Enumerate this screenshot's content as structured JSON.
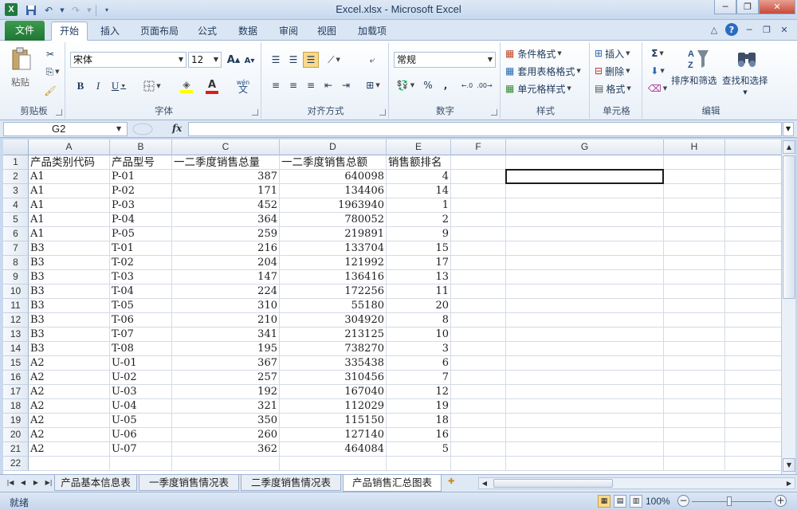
{
  "window": {
    "title": "Excel.xlsx - Microsoft Excel",
    "app_icon": "X",
    "minimize": "─",
    "restore": "❐",
    "close": "✕"
  },
  "tabs": {
    "file": "文件",
    "items": [
      "开始",
      "插入",
      "页面布局",
      "公式",
      "数据",
      "审阅",
      "视图",
      "加载项"
    ],
    "active": "开始"
  },
  "ribbon": {
    "clipboard": {
      "label": "剪贴板",
      "paste": "粘贴"
    },
    "font": {
      "label": "字体",
      "font_name": "宋体",
      "font_size": "12",
      "bold": "B",
      "italic": "I",
      "underline": "U",
      "grow": "A",
      "shrink": "A",
      "wen": "wén"
    },
    "alignment": {
      "label": "对齐方式"
    },
    "number": {
      "label": "数字",
      "format": "常规",
      "percent": "%",
      "comma": ","
    },
    "styles": {
      "label": "样式",
      "conditional": "条件格式",
      "table": "套用表格格式",
      "cell": "单元格样式"
    },
    "cells": {
      "label": "单元格",
      "insert": "插入",
      "delete": "删除",
      "format": "格式"
    },
    "editing": {
      "label": "编辑",
      "sort_filter": "排序和筛选",
      "find_select": "查找和选择",
      "sigma": "Σ"
    }
  },
  "formula_bar": {
    "name_box": "G2",
    "fx": "fx",
    "value": ""
  },
  "columns": [
    "A",
    "B",
    "C",
    "D",
    "E",
    "F",
    "G",
    "H",
    "I"
  ],
  "rows": [
    "1",
    "2",
    "3",
    "4",
    "5",
    "6",
    "7",
    "8",
    "9",
    "10",
    "11",
    "12",
    "13",
    "14",
    "15",
    "16",
    "17",
    "18",
    "19",
    "20",
    "21",
    "22"
  ],
  "table": {
    "headers": [
      "产品类别代码",
      "产品型号",
      "一二季度销售总量",
      "一二季度销售总额",
      "销售额排名"
    ],
    "data": [
      [
        "A1",
        "P-01",
        "387",
        "640098",
        "4"
      ],
      [
        "A1",
        "P-02",
        "171",
        "134406",
        "14"
      ],
      [
        "A1",
        "P-03",
        "452",
        "1963940",
        "1"
      ],
      [
        "A1",
        "P-04",
        "364",
        "780052",
        "2"
      ],
      [
        "A1",
        "P-05",
        "259",
        "219891",
        "9"
      ],
      [
        "B3",
        "T-01",
        "216",
        "133704",
        "15"
      ],
      [
        "B3",
        "T-02",
        "204",
        "121992",
        "17"
      ],
      [
        "B3",
        "T-03",
        "147",
        "136416",
        "13"
      ],
      [
        "B3",
        "T-04",
        "224",
        "172256",
        "11"
      ],
      [
        "B3",
        "T-05",
        "310",
        "55180",
        "20"
      ],
      [
        "B3",
        "T-06",
        "210",
        "304920",
        "8"
      ],
      [
        "B3",
        "T-07",
        "341",
        "213125",
        "10"
      ],
      [
        "B3",
        "T-08",
        "195",
        "738270",
        "3"
      ],
      [
        "A2",
        "U-01",
        "367",
        "335438",
        "6"
      ],
      [
        "A2",
        "U-02",
        "257",
        "310456",
        "7"
      ],
      [
        "A2",
        "U-03",
        "192",
        "167040",
        "12"
      ],
      [
        "A2",
        "U-04",
        "321",
        "112029",
        "19"
      ],
      [
        "A2",
        "U-05",
        "350",
        "115150",
        "18"
      ],
      [
        "A2",
        "U-06",
        "260",
        "127140",
        "16"
      ],
      [
        "A2",
        "U-07",
        "362",
        "464084",
        "5"
      ]
    ]
  },
  "sheets": {
    "items": [
      "产品基本信息表",
      "一季度销售情况表",
      "二季度销售情况表",
      "产品销售汇总图表"
    ],
    "active": "产品销售汇总图表"
  },
  "status": {
    "ready": "就绪",
    "zoom": "100%"
  }
}
